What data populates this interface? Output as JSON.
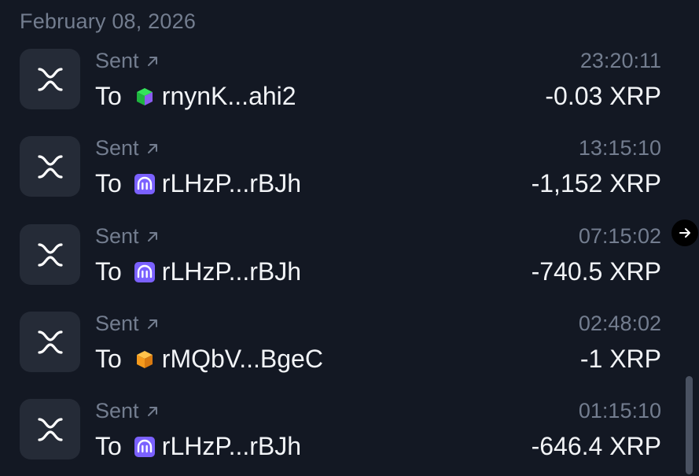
{
  "date_header": "February 08, 2026",
  "transactions": [
    {
      "type": "Sent",
      "to_label": "To",
      "address": "rnynK...ahi2",
      "counterparty_icon": "green-cube-icon",
      "time": "23:20:11",
      "amount": "-0.03 XRP"
    },
    {
      "type": "Sent",
      "to_label": "To",
      "address": "rLHzP...rBJh",
      "counterparty_icon": "kraken-icon",
      "time": "13:15:10",
      "amount": "-1,152 XRP"
    },
    {
      "type": "Sent",
      "to_label": "To",
      "address": "rLHzP...rBJh",
      "counterparty_icon": "kraken-icon",
      "time": "07:15:02",
      "amount": "-740.5 XRP"
    },
    {
      "type": "Sent",
      "to_label": "To",
      "address": "rMQbV...BgeC",
      "counterparty_icon": "orange-cube-icon",
      "time": "02:48:02",
      "amount": "-1 XRP"
    },
    {
      "type": "Sent",
      "to_label": "To",
      "address": "rLHzP...rBJh",
      "counterparty_icon": "kraken-icon",
      "time": "01:15:10",
      "amount": "-646.4 XRP"
    }
  ],
  "colors": {
    "background": "#131823",
    "icon_box": "#252b37",
    "muted_text": "#737d8f",
    "primary_text": "#f2f4f7",
    "kraken_purple": "#7b61ff"
  }
}
